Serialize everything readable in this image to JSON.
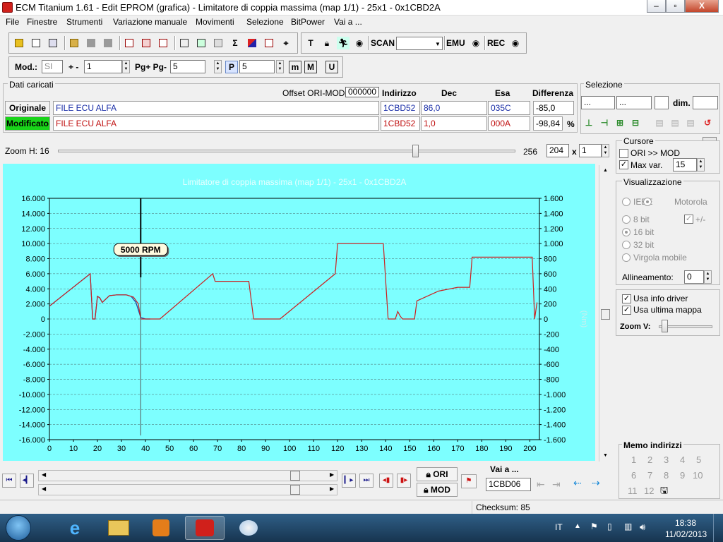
{
  "window": {
    "title": "ECM Titanium 1.61 - Edit EPROM (grafica) - Limitatore di coppia massima (map 1/1) - 25x1 - 0x1CBD2A",
    "minimize": "–",
    "maximize": "▫",
    "close": "X"
  },
  "menu": [
    "File",
    "Finestre",
    "Strumenti",
    "Variazione manuale",
    "Movimenti",
    "Selezione",
    "BitPower",
    "Vai a ..."
  ],
  "toolbar": {
    "scan": "SCAN",
    "emu": "EMU",
    "rec": "REC",
    "scan_select": ""
  },
  "toolbar2": {
    "mod_label": "Mod.:",
    "mod_value": "SI",
    "plusminus_label": "+ -",
    "plusminus_value": "1",
    "pg_label": "Pg+ Pg-",
    "pg_value": "5",
    "p_value": "5",
    "p_icon": "P",
    "m_icon": "m",
    "M_icon": "M",
    "u_icon": "U"
  },
  "dati": {
    "title": "Dati caricati",
    "offset_label": "Offset ORI-MOD",
    "offset_value": "000000",
    "col_indirizzo": "Indirizzo",
    "col_dec": "Dec",
    "col_esa": "Esa",
    "col_diff": "Differenza",
    "orig_label": "Originale",
    "orig_file": "FILE ECU ALFA",
    "orig_addr": "1CBD52",
    "orig_dec": "86,0",
    "orig_esa": "035C",
    "orig_diff": "-85,0",
    "mod_label": "Modificato",
    "mod_file": "FILE ECU ALFA",
    "mod_addr": "1CBD52",
    "mod_dec": "1,0",
    "mod_esa": "000A",
    "mod_diff": "-98,84",
    "pct": "%"
  },
  "selezione": {
    "title": "Selezione",
    "f1": "...",
    "f2": "...",
    "f3": "",
    "dim_label": "dim.",
    "dim_value": ""
  },
  "zoom": {
    "label": "Zoom H: 16",
    "val1": "256",
    "val2": "204",
    "x": "x",
    "val3": "1",
    "zoom_v": "Zoom V:"
  },
  "cursore": {
    "title": "Cursore",
    "ori_mod": "ORI >> MOD",
    "maxvar": "Max var.",
    "maxvar_value": "15"
  },
  "visualizzazione": {
    "title": "Visualizzazione",
    "ieee": "IEEE",
    "motorola": "Motorola",
    "b8": "8 bit",
    "pm": "+/-",
    "b16": "16 bit",
    "b32": "32 bit",
    "virgola": "Virgola mobile",
    "allineamento": "Allineamento:",
    "allineamento_value": "0",
    "usa_info": "Usa info driver",
    "usa_ultima": "Usa ultima mappa"
  },
  "memo": {
    "title": "Memo indirizzi",
    "items": [
      "1",
      "2",
      "3",
      "4",
      "5",
      "6",
      "7",
      "8",
      "9",
      "10",
      "11",
      "12"
    ]
  },
  "nav": {
    "ori": "ORI",
    "mod": "MOD",
    "vai_a": "Vai a ...",
    "vai_value": "1CBD06"
  },
  "status": {
    "checksum": "Checksum: 85"
  },
  "taskbar": {
    "lang": "IT",
    "time": "18:38",
    "date": "11/02/2013"
  },
  "chart_data": {
    "type": "line",
    "title": "Limitatore di coppia massima (map 1/1) - 25x1 - 0x1CBD2A",
    "cursor_label": "5000 RPM",
    "cursor_x": 38,
    "y_right_label": "(Nm)",
    "xlim": [
      0,
      204
    ],
    "ylim": [
      -16000,
      16000
    ],
    "ylim_right": [
      -1600,
      1600
    ],
    "x_ticks": [
      0,
      10,
      20,
      30,
      40,
      50,
      60,
      70,
      80,
      90,
      100,
      110,
      120,
      130,
      140,
      150,
      160,
      170,
      180,
      190,
      200
    ],
    "y_ticks": [
      16000,
      14000,
      12000,
      10000,
      8000,
      6000,
      4000,
      2000,
      0,
      -2000,
      -4000,
      -6000,
      -8000,
      -10000,
      -12000,
      -14000,
      -16000
    ],
    "y_tick_labels": [
      "16.000",
      "14.000",
      "12.000",
      "10.000",
      "8.000",
      "6.000",
      "4.000",
      "2.000",
      "0",
      "-2.000",
      "-4.000",
      "-6.000",
      "-8.000",
      "-10.000",
      "-12.000",
      "-14.000",
      "-16.000"
    ],
    "y_right_ticks": [
      1600,
      1400,
      1200,
      1000,
      800,
      600,
      400,
      200,
      0,
      -200,
      -400,
      -600,
      -800,
      -1000,
      -1200,
      -1400,
      -1600
    ],
    "y_right_tick_labels": [
      "1.600",
      "1.400",
      "1.200",
      "1.000",
      "800",
      "600",
      "400",
      "200",
      "0",
      "-200",
      "-400",
      "-600",
      "-800",
      "-1.000",
      "-1.200",
      "-1.400",
      "-1.600"
    ],
    "grid": true,
    "colors": {
      "bg": "#7dffff",
      "mod": "#cc2020",
      "ori": "#1a3fa0",
      "cursor": "#000000",
      "grid": "#4a6a6a"
    },
    "series": [
      {
        "values": [
          [
            0,
            1700
          ],
          [
            17,
            6000
          ],
          [
            18,
            0
          ],
          [
            19,
            0
          ],
          [
            20,
            3000
          ],
          [
            21,
            2800
          ],
          [
            22,
            2200
          ],
          [
            25,
            3100
          ],
          [
            28,
            3200
          ],
          [
            32,
            3200
          ],
          [
            35,
            2900
          ],
          [
            37,
            2000
          ],
          [
            38,
            0
          ],
          [
            46,
            0
          ],
          [
            68,
            6000
          ],
          [
            69,
            5000
          ],
          [
            83,
            5000
          ],
          [
            85,
            0
          ],
          [
            96,
            0
          ],
          [
            119,
            6000
          ],
          [
            120,
            10000
          ],
          [
            139,
            10000
          ],
          [
            141,
            0
          ],
          [
            144,
            0
          ],
          [
            145,
            1000
          ],
          [
            146,
            400
          ],
          [
            147,
            0
          ],
          [
            152,
            0
          ],
          [
            153,
            2400
          ],
          [
            162,
            3700
          ],
          [
            170,
            4200
          ],
          [
            172,
            4200
          ],
          [
            175,
            4200
          ],
          [
            176,
            8200
          ],
          [
            201,
            8200
          ],
          [
            202,
            0
          ],
          [
            203,
            2200
          ]
        ]
      },
      {
        "values": [
          [
            0,
            1700
          ],
          [
            17,
            6000
          ],
          [
            18,
            0
          ],
          [
            19,
            0
          ],
          [
            20,
            3000
          ],
          [
            21,
            2800
          ],
          [
            22,
            2200
          ],
          [
            25,
            3100
          ],
          [
            28,
            3200
          ],
          [
            32,
            3200
          ],
          [
            34,
            3000
          ],
          [
            36,
            2200
          ],
          [
            37,
            1200
          ],
          [
            38,
            200
          ],
          [
            40,
            0
          ],
          [
            42,
            0
          ]
        ]
      }
    ]
  }
}
